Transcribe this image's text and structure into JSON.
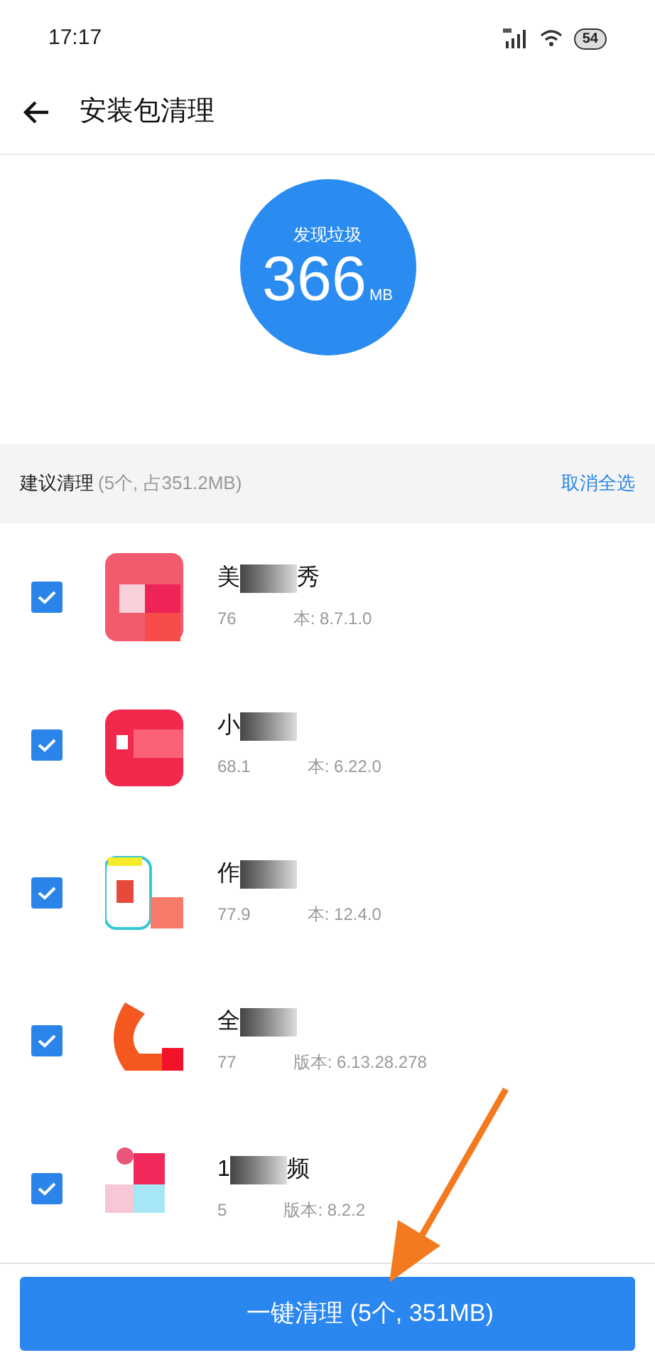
{
  "status_bar": {
    "time": "17:17",
    "battery": "54"
  },
  "header": {
    "title": "安装包清理"
  },
  "summary": {
    "label": "发现垃圾",
    "size": "366",
    "unit": "MB"
  },
  "section": {
    "title": "建议清理",
    "count": "(5个, 占351.2MB)",
    "action": "取消全选"
  },
  "apps": [
    {
      "name": [
        "美",
        "秀"
      ],
      "detail": [
        "76",
        "本: 8.7.1.0"
      ],
      "checked": true
    },
    {
      "name": [
        "小"
      ],
      "detail": [
        "68.1",
        "本: 6.22.0"
      ],
      "checked": true
    },
    {
      "name": [
        "作"
      ],
      "detail": [
        "77.9",
        "本: 12.4.0"
      ],
      "checked": true
    },
    {
      "name": [
        "全"
      ],
      "detail": [
        "77",
        "版本: 6.13.28.278"
      ],
      "checked": true
    },
    {
      "name": [
        "1",
        "频"
      ],
      "detail": [
        "5",
        "版本: 8.2.2"
      ],
      "checked": true
    }
  ],
  "clean_button": {
    "label": "一键清理 (5个, 351MB)"
  }
}
